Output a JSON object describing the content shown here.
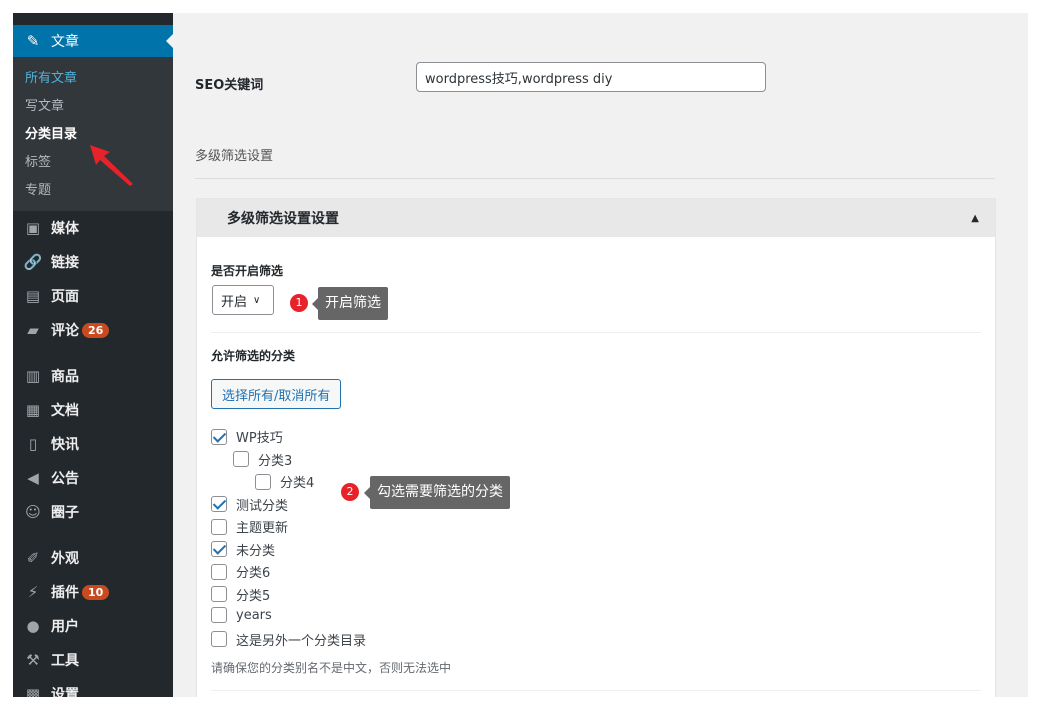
{
  "sidebar": {
    "active": {
      "label": "文章",
      "icon": "pin-icon"
    },
    "submenu": [
      "所有文章",
      "写文章",
      "分类目录",
      "标签",
      "专题"
    ],
    "items": [
      {
        "label": "媒体",
        "icon": "media-icon"
      },
      {
        "label": "链接",
        "icon": "link-icon"
      },
      {
        "label": "页面",
        "icon": "pages-icon"
      },
      {
        "label": "评论",
        "icon": "comment-icon",
        "badge": "26"
      },
      {
        "label": "商品",
        "icon": "products-icon"
      },
      {
        "label": "文档",
        "icon": "docs-icon"
      },
      {
        "label": "快讯",
        "icon": "news-icon"
      },
      {
        "label": "公告",
        "icon": "megaphone-icon"
      },
      {
        "label": "圈子",
        "icon": "community-icon"
      },
      {
        "label": "外观",
        "icon": "appearance-icon"
      },
      {
        "label": "插件",
        "icon": "plugin-icon",
        "badge": "10"
      },
      {
        "label": "用户",
        "icon": "user-icon"
      },
      {
        "label": "工具",
        "icon": "wrench-icon"
      },
      {
        "label": "设置",
        "icon": "settings-icon"
      }
    ]
  },
  "main": {
    "seo_label": "SEO关键词",
    "seo_value": "wordpress技巧,wordpress diy",
    "section_title": "多级筛选设置",
    "panel_title": "多级筛选设置设置",
    "enable_label": "是否开启筛选",
    "enable_value": "开启",
    "allowed_label": "允许筛选的分类",
    "select_all_button": "选择所有/取消所有",
    "categories": [
      {
        "label": "WP技巧",
        "checked": true
      },
      {
        "label": "分类3",
        "checked": false
      },
      {
        "label": "分类4",
        "checked": false
      },
      {
        "label": "测试分类",
        "checked": true
      },
      {
        "label": "主题更新",
        "checked": false
      },
      {
        "label": "未分类",
        "checked": true
      },
      {
        "label": "分类6",
        "checked": false
      },
      {
        "label": "分类5",
        "checked": false
      },
      {
        "label": "years",
        "checked": false
      },
      {
        "label": "这是另外一个分类目录",
        "checked": false
      }
    ],
    "note": "请确保您的分类别名不是中文，否则无法选中"
  },
  "annotations": [
    {
      "number": "1",
      "text": "开启筛选"
    },
    {
      "number": "2",
      "text": "勾选需要筛选的分类"
    }
  ],
  "colors": {
    "accent": "#0073aa",
    "sidebar": "#23282d",
    "badge": "#ca4a1f",
    "marker": "#e8222b"
  }
}
